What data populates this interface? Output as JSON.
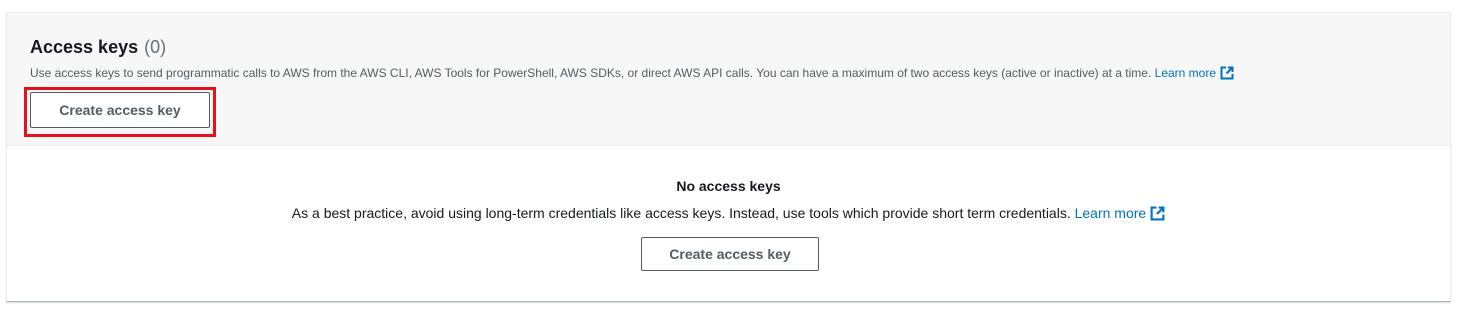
{
  "section": {
    "title": "Access keys",
    "count": "(0)",
    "description": "Use access keys to send programmatic calls to AWS from the AWS CLI, AWS Tools for PowerShell, AWS SDKs, or direct AWS API calls. You can have a maximum of two access keys (active or inactive) at a time.",
    "learn_more_label": "Learn more",
    "create_button_label": "Create access key"
  },
  "empty_state": {
    "title": "No access keys",
    "description": "As a best practice, avoid using long-term credentials like access keys. Instead, use tools which provide short term credentials.",
    "learn_more_label": "Learn more",
    "create_button_label": "Create access key"
  },
  "colors": {
    "link": "#0073bb",
    "highlight": "#e5111e",
    "header_bg": "#f7f7f8",
    "button_text": "#545b64"
  },
  "icons": {
    "external_link": "external-link-icon"
  }
}
